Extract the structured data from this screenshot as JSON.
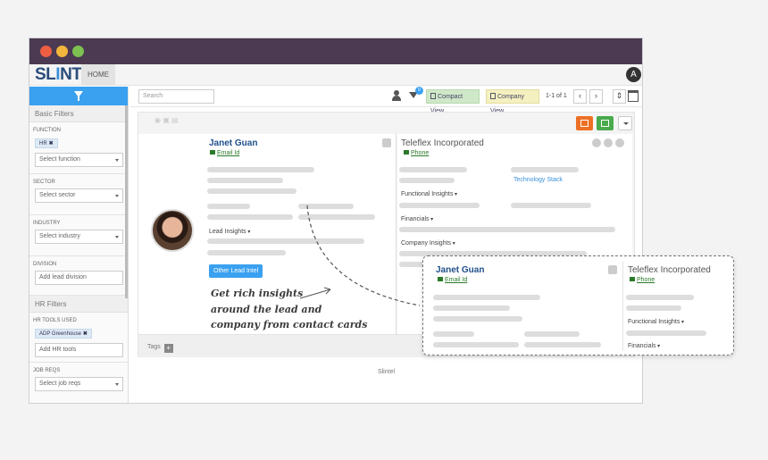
{
  "app": {
    "logo_text_1": "SL",
    "logo_text_2": "I",
    "logo_text_3": "NTEL",
    "home_tab": "HOME",
    "user_initial": "A"
  },
  "sidebar": {
    "basic_filters": "Basic Filters",
    "function_label": "FUNCTION",
    "function_chip": "HR",
    "function_placeholder": "Select function",
    "sector_label": "SECTOR",
    "sector_placeholder": "Select sector",
    "industry_label": "INDUSTRY",
    "industry_placeholder": "Select industry",
    "division_label": "DIVISION",
    "division_placeholder": "Add lead division",
    "hr_filters": "HR Filters",
    "hr_tools_label": "HR TOOLS USED",
    "hr_tools_chip": "ADP Greenhouse",
    "hr_tools_placeholder": "Add HR tools",
    "job_reqs_label": "JOB REQS",
    "job_reqs_placeholder": "Select job reqs"
  },
  "toolbar": {
    "search_placeholder": "Search",
    "filter_badge": "0",
    "compact_view": "Compact View",
    "company_view": "Company View",
    "pager": "1-1 of 1",
    "prev": "‹",
    "next": "›",
    "sort": "⇕"
  },
  "lead": {
    "name": "Janet Guan",
    "email_link": "Email Id",
    "lead_insights": "Lead Insights",
    "other_btn": "Other Lead Intel"
  },
  "company": {
    "name": "Teleflex Incorporated",
    "phone_link": "Phone",
    "tech_stack": "Technology Stack",
    "functional_insights": "Functional Insights",
    "financials": "Financials",
    "company_insights": "Company Insights"
  },
  "annotation": {
    "line1": "Get rich insights",
    "line2": "around the lead and",
    "line3": "company from contact cards"
  },
  "tags_label": "Tags",
  "tags_add": "+",
  "footer": "Slintel",
  "zoom": {
    "lead_name": "Janet Guan",
    "email_link": "Email Id",
    "company_name": "Teleflex Incorporated",
    "phone_link": "Phone",
    "functional_insights": "Functional Insights",
    "financials": "Financials"
  }
}
